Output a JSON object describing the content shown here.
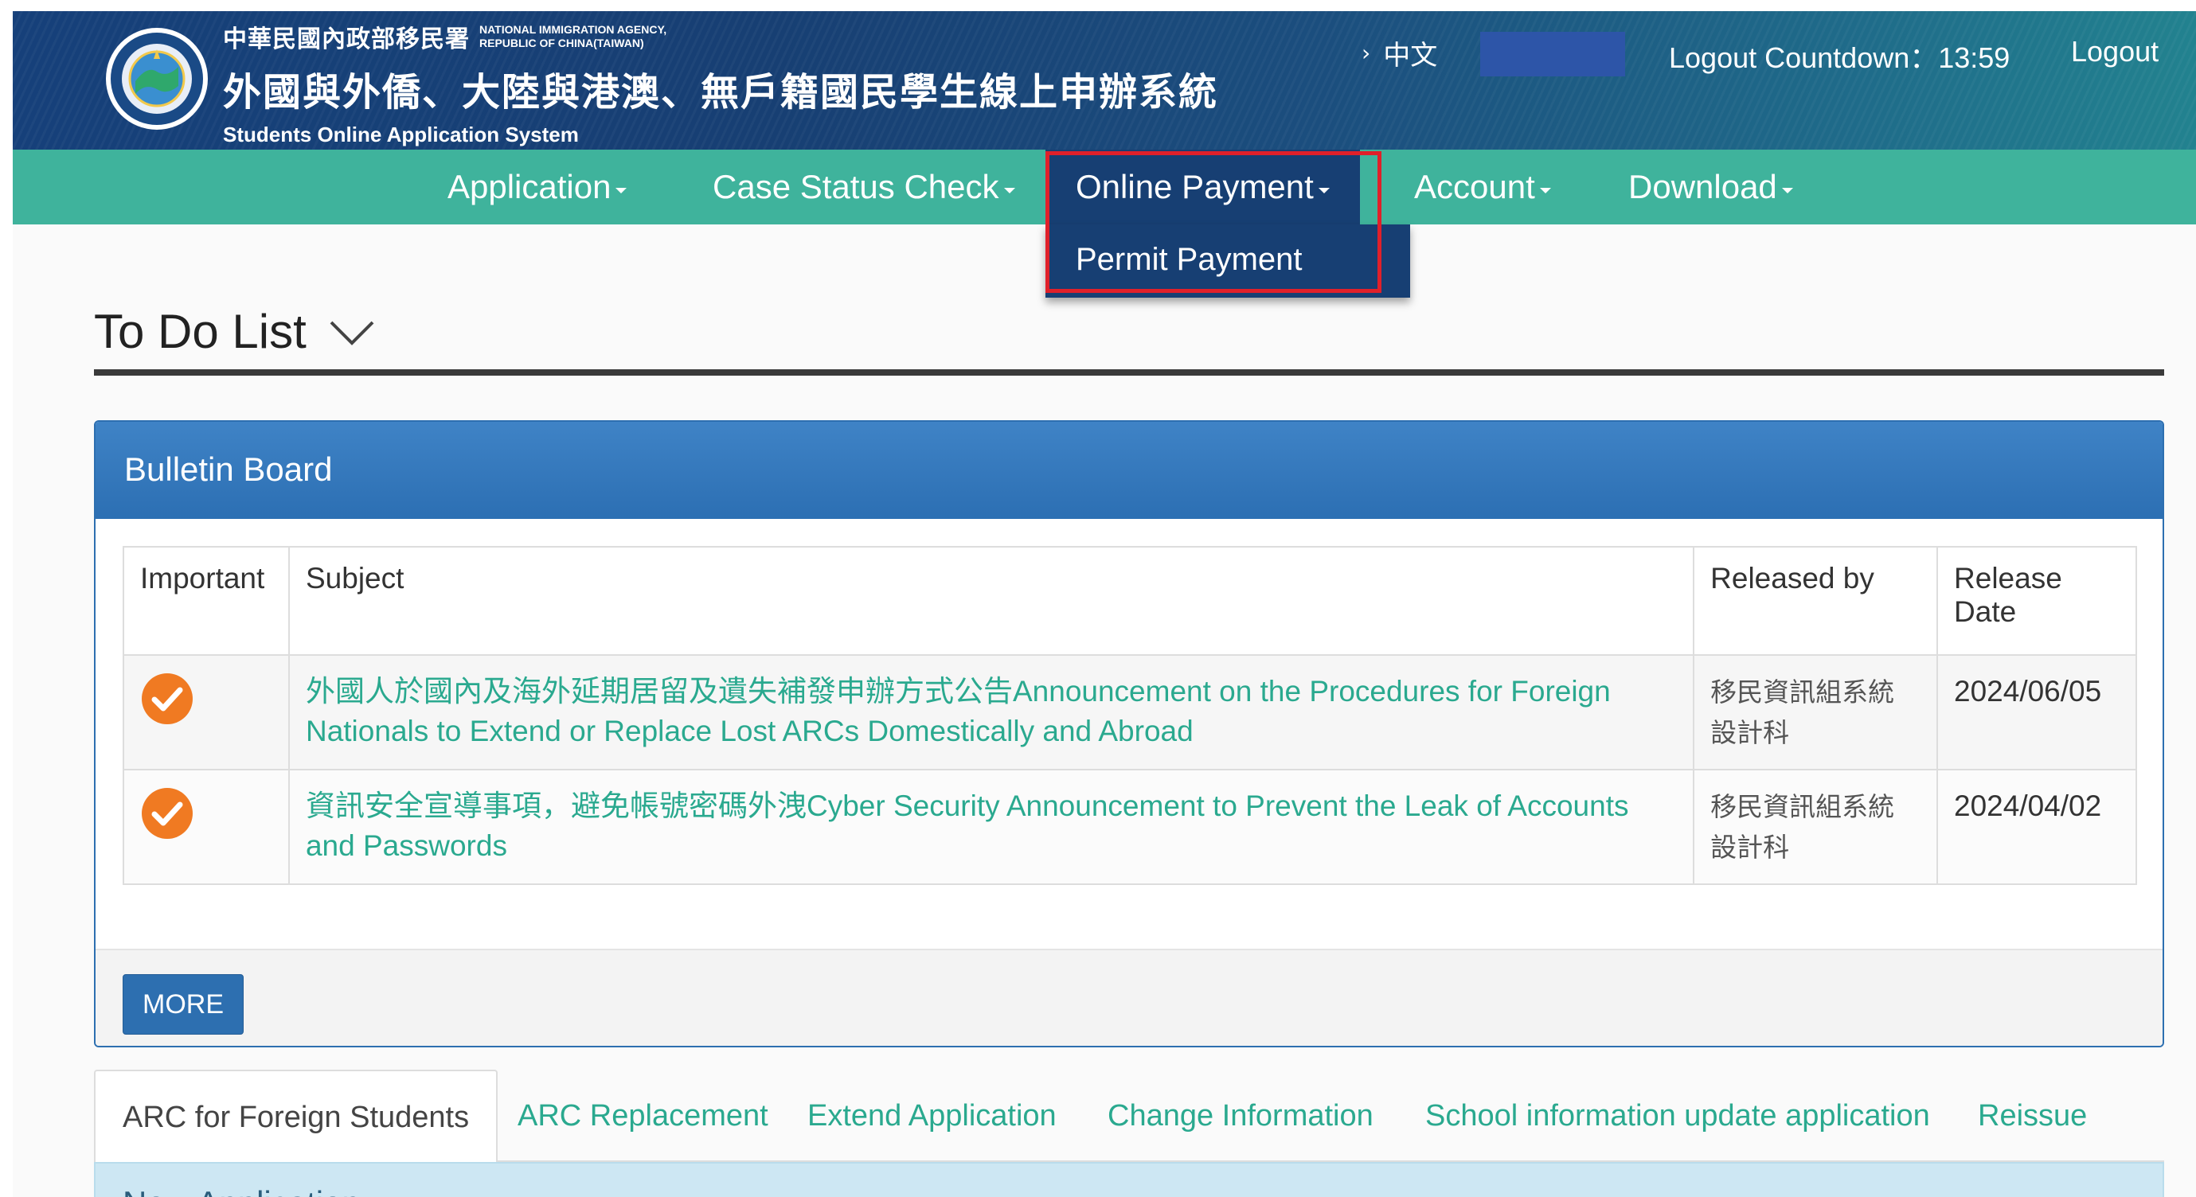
{
  "header": {
    "agency_zh": "中華民國內政部移民署",
    "agency_en_line1": "NATIONAL IMMIGRATION AGENCY,",
    "agency_en_line2": "REPUBLIC OF CHINA(TAIWAN)",
    "system_zh": "外國與外僑、大陸與港澳、無戶籍國民學生線上申辦系統",
    "system_en": "Students Online Application System",
    "language_link": "中文",
    "countdown": "Logout Countdown：13:59",
    "logout": "Logout",
    "logo_icon": "agency-seal-icon"
  },
  "nav": {
    "items": [
      {
        "label": "Application"
      },
      {
        "label": "Case Status Check"
      },
      {
        "label": "Online Payment"
      },
      {
        "label": "Account"
      },
      {
        "label": "Download"
      }
    ],
    "open_dropdown": {
      "parent": "Online Payment",
      "items": [
        {
          "label": "Permit Payment"
        }
      ]
    }
  },
  "todo": {
    "title": "To Do List"
  },
  "bulletin": {
    "title": "Bulletin Board",
    "columns": [
      "Important",
      "Subject",
      "Released by",
      "Release Date"
    ],
    "rows": [
      {
        "important": true,
        "subject": "外國人於國內及海外延期居留及遺失補發申辦方式公告Announcement on the Procedures for Foreign Nationals to Extend or Replace Lost ARCs Domestically and Abroad",
        "released_by": "移民資訊組系統設計科",
        "release_date": "2024/06/05"
      },
      {
        "important": true,
        "subject": "資訊安全宣導事項，避免帳號密碼外洩Cyber Security Announcement to Prevent the Leak of Accounts and Passwords",
        "released_by": "移民資訊組系統設計科",
        "release_date": "2024/04/02"
      }
    ],
    "more_button": "MORE"
  },
  "tabs": [
    {
      "label": "ARC for Foreign Students",
      "active": true
    },
    {
      "label": "ARC Replacement",
      "active": false
    },
    {
      "label": "Extend Application",
      "active": false
    },
    {
      "label": "Change Information",
      "active": false
    },
    {
      "label": "School information update application",
      "active": false
    },
    {
      "label": "Reissue",
      "active": false
    }
  ],
  "new_application": {
    "title": "New Application"
  },
  "colors": {
    "header_navy": "#173f73",
    "nav_teal": "#3fb39c",
    "link_green": "#2aa98f",
    "panel_blue": "#2d6fb0",
    "highlight_red": "#e0202a",
    "check_orange": "#f07a22"
  }
}
